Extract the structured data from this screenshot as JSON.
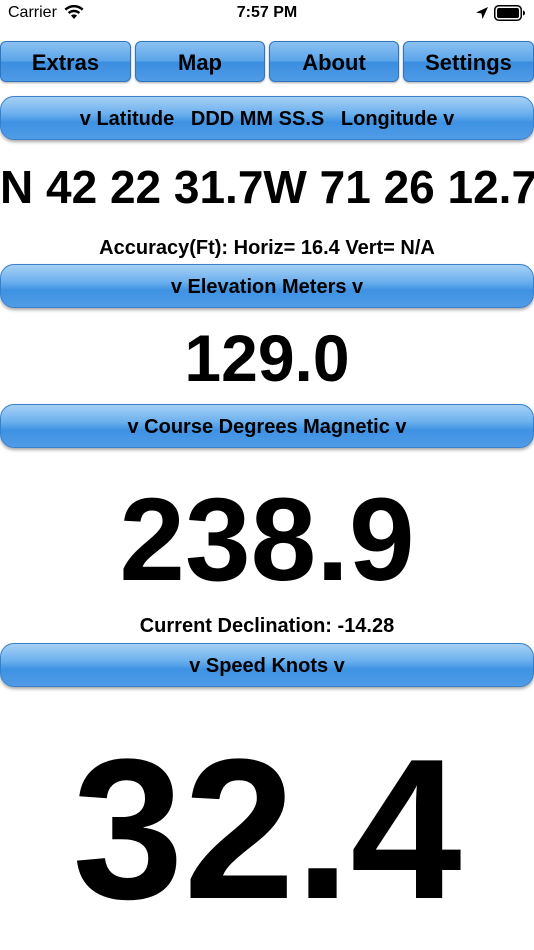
{
  "status_bar": {
    "carrier": "Carrier",
    "time": "7:57 PM",
    "icons": [
      "wifi-icon",
      "location-arrow-icon",
      "battery-icon"
    ]
  },
  "tabs": [
    {
      "label": "Extras"
    },
    {
      "label": "Map"
    },
    {
      "label": "About"
    },
    {
      "label": "Settings"
    }
  ],
  "position": {
    "selector_label": "v Latitude   DDD MM SS.S   Longitude v",
    "value": "N 42 22 31.7W 71 26 12.7",
    "accuracy": "Accuracy(Ft): Horiz= 16.4 Vert= N/A"
  },
  "elevation": {
    "selector_label": "v Elevation Meters v",
    "value": "129.0"
  },
  "course": {
    "selector_label": "v Course Degrees Magnetic v",
    "value": "238.9",
    "declination": "Current Declination: -14.28"
  },
  "speed": {
    "selector_label": "v Speed Knots v",
    "value": "32.4"
  },
  "colors": {
    "button_blue": "#4f9be6",
    "button_highlight": "#a6d0f4",
    "text": "#000000",
    "background": "#ffffff"
  }
}
